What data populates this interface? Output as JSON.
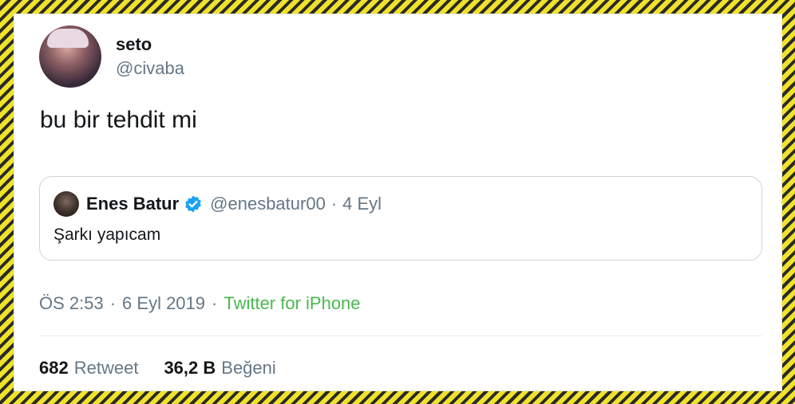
{
  "author": {
    "name": "seto",
    "handle": "@civaba"
  },
  "tweet": {
    "text": "bu bir tehdit mi"
  },
  "quoted": {
    "name": "Enes Batur",
    "handle": "@enesbatur00",
    "separator": "·",
    "date": "4 Eyl",
    "text": "Şarkı yapıcam",
    "verified_color": "#1da1f2"
  },
  "meta": {
    "time": "ÖS 2:53",
    "separator": "·",
    "date": "6 Eyl 2019",
    "source": "Twitter for iPhone",
    "source_color": "#4bb84f"
  },
  "stats": {
    "retweets_count": "682",
    "retweets_label": "Retweet",
    "likes_count": "36,2 B",
    "likes_label": "Beğeni"
  },
  "colors": {
    "border_stripe_yellow": "#f0e22a",
    "border_stripe_dark": "#2a2a2a"
  }
}
